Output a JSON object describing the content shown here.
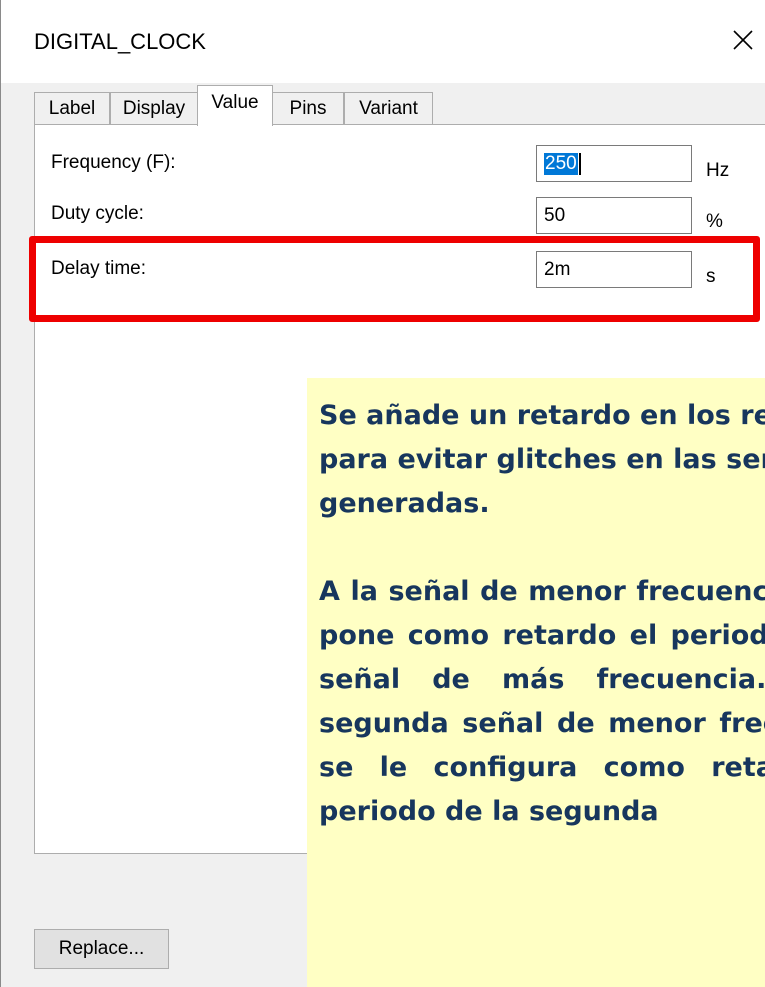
{
  "window": {
    "title": "DIGITAL_CLOCK",
    "close_icon": "close-icon"
  },
  "tabs": [
    {
      "label": "Label",
      "active": false
    },
    {
      "label": "Display",
      "active": false
    },
    {
      "label": "Value",
      "active": true
    },
    {
      "label": "Pins",
      "active": false
    },
    {
      "label": "Variant",
      "active": false
    }
  ],
  "fields": {
    "frequency": {
      "label": "Frequency (F):",
      "value": "250",
      "unit": "Hz"
    },
    "duty_cycle": {
      "label": "Duty cycle:",
      "value": "50",
      "unit": "%"
    },
    "delay_time": {
      "label": "Delay time:",
      "value": "2m",
      "unit": "s"
    }
  },
  "buttons": {
    "replace": "Replace..."
  },
  "annotation": {
    "highlight_color": "#ee0000",
    "note_background": "#ffffc4",
    "note_text_color": "#17365d",
    "paragraph1": "Se añade un retardo en los relojes para evitar glitches en las señales generadas.",
    "paragraph2": "A la señal de menor frecuencia se le pone como retardo el periodo de la señal de más frecuencia. A la segunda señal de menor frecuencia se le configura como retardo el periodo de la segunda"
  }
}
